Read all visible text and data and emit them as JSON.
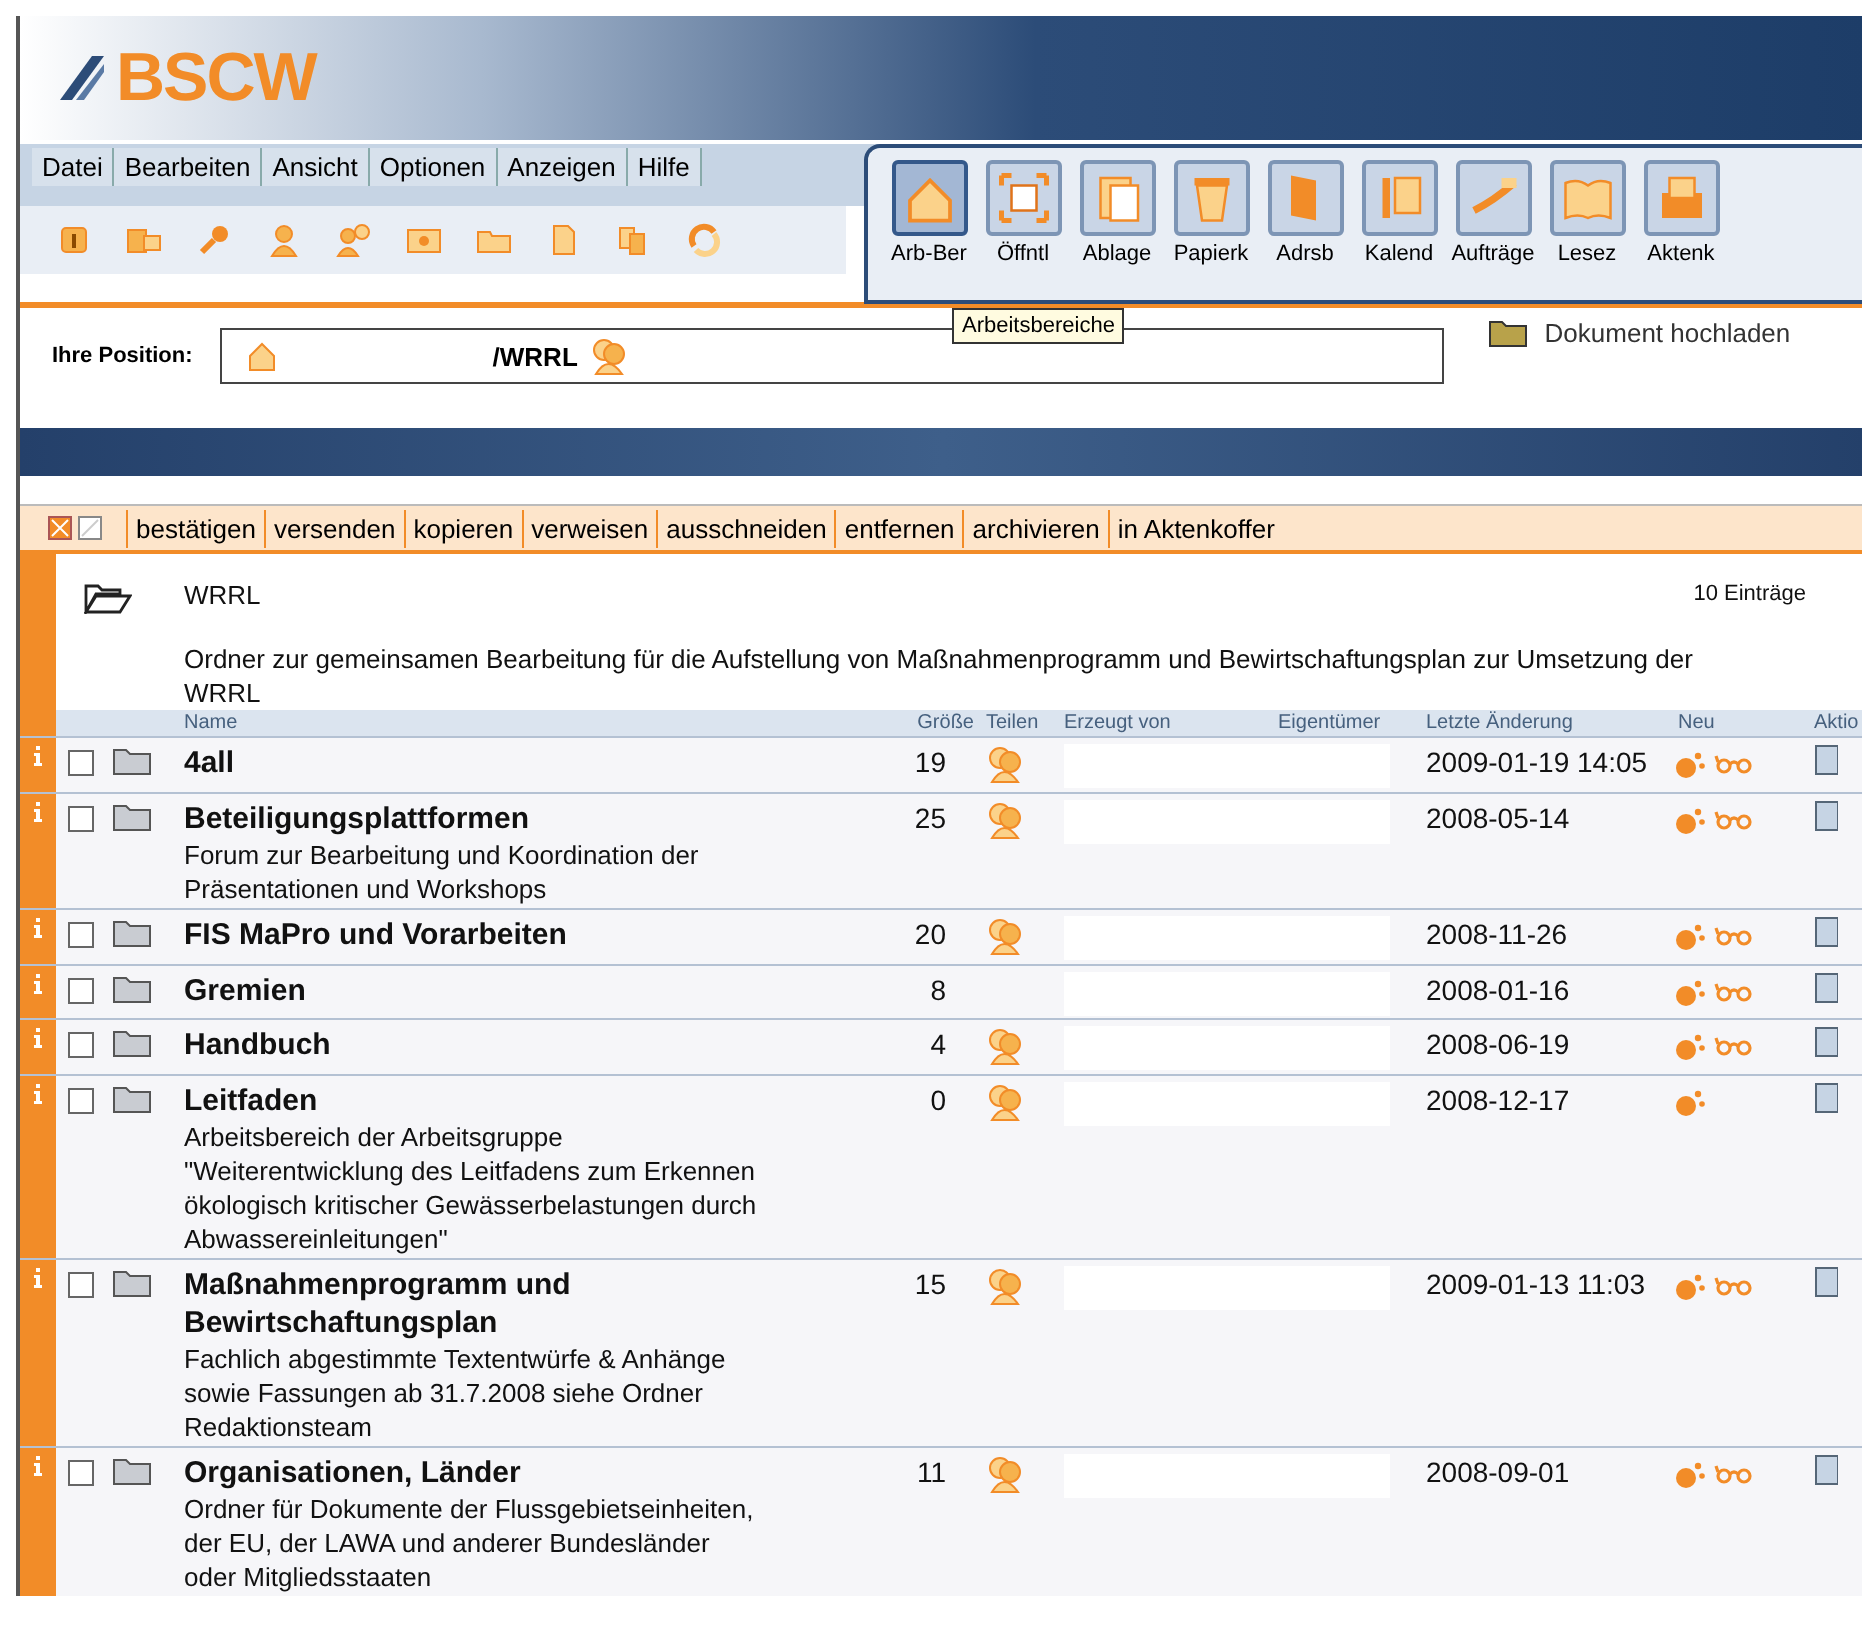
{
  "logo": {
    "text": "BSCW"
  },
  "menu": [
    "Datei",
    "Bearbeiten",
    "Ansicht",
    "Optionen",
    "Anzeigen",
    "Hilfe"
  ],
  "small_tools": [
    {
      "kind": "info"
    },
    {
      "kind": "move"
    },
    {
      "kind": "key"
    },
    {
      "kind": "user"
    },
    {
      "kind": "users"
    },
    {
      "kind": "center"
    },
    {
      "kind": "folder"
    },
    {
      "kind": "document"
    },
    {
      "kind": "copy"
    },
    {
      "kind": "refresh"
    }
  ],
  "big_tools": [
    {
      "label": "Arb-Ber",
      "selected": true
    },
    {
      "label": "Öffntl",
      "selected": false
    },
    {
      "label": "Ablage",
      "selected": false
    },
    {
      "label": "Papierk",
      "selected": false
    },
    {
      "label": "Adrsb",
      "selected": false
    },
    {
      "label": "Kalend",
      "selected": false
    },
    {
      "label": "Aufträge",
      "selected": false
    },
    {
      "label": "Lesez",
      "selected": false
    },
    {
      "label": "Aktenk",
      "selected": false
    }
  ],
  "tooltip": "Arbeitsbereiche",
  "position": {
    "label": "Ihre Position:",
    "path": "/WRRL"
  },
  "upload": "Dokument hochladen",
  "actions": [
    "bestätigen",
    "versenden",
    "kopieren",
    "verweisen",
    "ausschneiden",
    "entfernen",
    "archivieren",
    "in Aktenkoffer"
  ],
  "folder": {
    "name": "WRRL",
    "count": "10 Einträge",
    "description": "Ordner zur gemeinsamen Bearbeitung für die Aufstellung von Maßnahmenprogramm und Bewirtschaftungsplan zur Umsetzung der WRRL"
  },
  "columns": [
    "Name",
    "Größe",
    "Teilen",
    "Erzeugt von",
    "Eigentümer",
    "Letzte Änderung",
    "Neu",
    "Aktio"
  ],
  "rows": [
    {
      "name": "4all",
      "size": "19",
      "shared": true,
      "modified": "2009-01-19 14:05",
      "read": true,
      "checked": false
    },
    {
      "name": "Beteiligungsplattformen",
      "description": "Forum zur Bearbeitung und Koordination der Präsentationen und Workshops",
      "size": "25",
      "shared": true,
      "modified": "2008-05-14",
      "read": true,
      "checked": false
    },
    {
      "name": "FIS MaPro und Vorarbeiten",
      "size": "20",
      "shared": true,
      "modified": "2008-11-26",
      "read": true,
      "checked": false
    },
    {
      "name": "Gremien",
      "size": "8",
      "shared": false,
      "modified": "2008-01-16",
      "read": true,
      "checked": false
    },
    {
      "name": "Handbuch",
      "size": "4",
      "shared": true,
      "modified": "2008-06-19",
      "read": true,
      "checked": false
    },
    {
      "name": "Leitfaden",
      "description": "Arbeitsbereich der Arbeitsgruppe \"Weiterentwicklung des Leitfadens zum Erkennen ökologisch kritischer Gewässerbelastungen durch Abwassereinleitungen\"",
      "size": "0",
      "shared": true,
      "modified": "2008-12-17",
      "read": false,
      "checked": false
    },
    {
      "name": "Maßnahmenprogramm und Bewirtschaftungsplan",
      "description": "Fachlich abgestimmte Textentwürfe & Anhänge sowie Fassungen ab 31.7.2008 siehe Ordner Redaktionsteam",
      "size": "15",
      "shared": true,
      "modified": "2009-01-13 11:03",
      "read": true,
      "checked": false
    },
    {
      "name": "Organisationen, Länder",
      "description": "Ordner für Dokumente der Flussgebietseinheiten, der EU, der LAWA und anderer Bundesländer oder Mitgliedsstaaten",
      "size": "11",
      "shared": true,
      "modified": "2008-09-01",
      "read": true,
      "checked": false
    }
  ]
}
